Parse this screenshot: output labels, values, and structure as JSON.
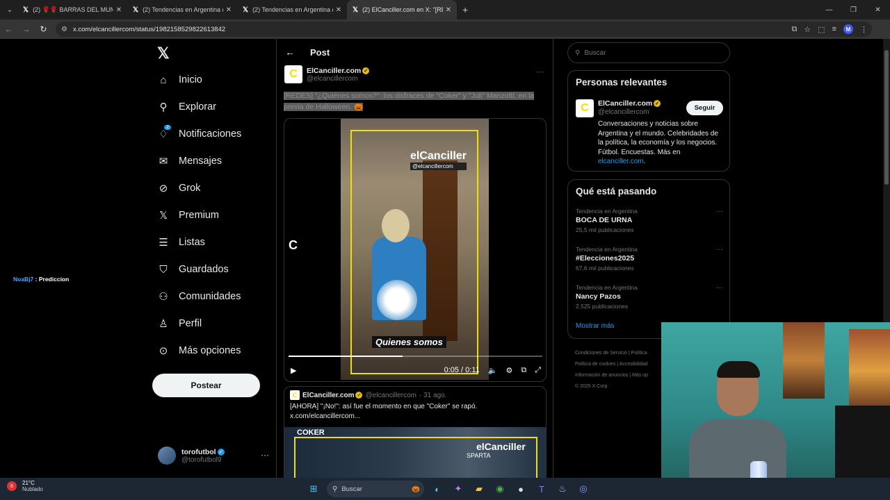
{
  "browser": {
    "tabs": [
      {
        "title": "(2) 🌹🌹 BARRAS DEL MUNDO 🌹",
        "active": false
      },
      {
        "title": "(2) Tendencias en Argentina en",
        "active": false
      },
      {
        "title": "(2) Tendencias en Argentina en",
        "active": false
      },
      {
        "title": "(2) ElCanciller.com en X: \"[REDE",
        "active": true
      }
    ],
    "url": "x.com/elcancillercom/status/1982158529822613842",
    "profile_initial": "M"
  },
  "overlay": {
    "user": "NoaBj7",
    "text": " : Prediccion"
  },
  "nav": {
    "items": [
      {
        "label": "Inicio",
        "icon": "home-icon"
      },
      {
        "label": "Explorar",
        "icon": "search-icon"
      },
      {
        "label": "Notificaciones",
        "icon": "bell-icon",
        "badge": "2"
      },
      {
        "label": "Mensajes",
        "icon": "mail-icon"
      },
      {
        "label": "Grok",
        "icon": "grok-icon"
      },
      {
        "label": "Premium",
        "icon": "x-icon"
      },
      {
        "label": "Listas",
        "icon": "list-icon"
      },
      {
        "label": "Guardados",
        "icon": "bookmark-icon"
      },
      {
        "label": "Comunidades",
        "icon": "community-icon"
      },
      {
        "label": "Perfil",
        "icon": "person-icon"
      },
      {
        "label": "Más opciones",
        "icon": "more-circle-icon"
      }
    ],
    "post_label": "Postear",
    "account": {
      "name": "torofutbol",
      "handle": "@torofutbol9"
    }
  },
  "post": {
    "header_title": "Post",
    "author": {
      "name": "ElCanciller.com",
      "handle": "@elcancillercom",
      "avatar": "C"
    },
    "text": "[REDES] \"¿Quiénes somos?\": los disfraces de \"Coker\" y \"Juli\" Manzotti, en la previa de Halloween. 🎃",
    "video": {
      "brand": "elCanciller",
      "brand_handle": "@elcancillercom",
      "overlay_c": "C",
      "caption": "Quienes somos",
      "time": "0:05 / 0:11",
      "progress": 0.45
    },
    "quote": {
      "name": "ElCanciller.com",
      "handle": "@elcancillercom",
      "date": "· 31 ago.",
      "text": "[AHORA] \"¡No!\": así fue el momento en que \"Coker\" se rapó. x.com/elcancillercom...",
      "img_label1": "COKER",
      "img_label2": "elCanciller",
      "img_label3": "SPARTA"
    }
  },
  "sidebar": {
    "search_placeholder": "Buscar",
    "relevant": {
      "title": "Personas relevantes",
      "name": "ElCanciller.com",
      "handle": "@elcancillercom",
      "follow": "Seguir",
      "bio": "Conversaciones y noticias sobre Argentina y el mundo. Celebridades de la política, la economía y los negocios. Fútbol. Encuestas. Más en",
      "link": "elcanciller.com",
      "bio_end": "."
    },
    "trending": {
      "title": "Qué está pasando",
      "items": [
        {
          "context": "Tendencia en Argentina",
          "name": "BOCA DE URNA",
          "count": "25,5 mil publicaciones"
        },
        {
          "context": "Tendencia en Argentina",
          "name": "#Elecciones2025",
          "count": "67,6 mil publicaciones"
        },
        {
          "context": "Tendencia en Argentina",
          "name": "Nancy Pazos",
          "count": "2.525 publicaciones"
        }
      ],
      "show_more": "Mostrar más"
    },
    "footer": [
      "Condiciones de Servicio | Política",
      "Política de cookies | Accesibilidad",
      "Información de anuncios | Más op",
      "© 2025 X Corp."
    ]
  },
  "taskbar": {
    "weather_badge": "6",
    "temp": "21°C",
    "condition": "Nublado",
    "search": "Buscar"
  }
}
